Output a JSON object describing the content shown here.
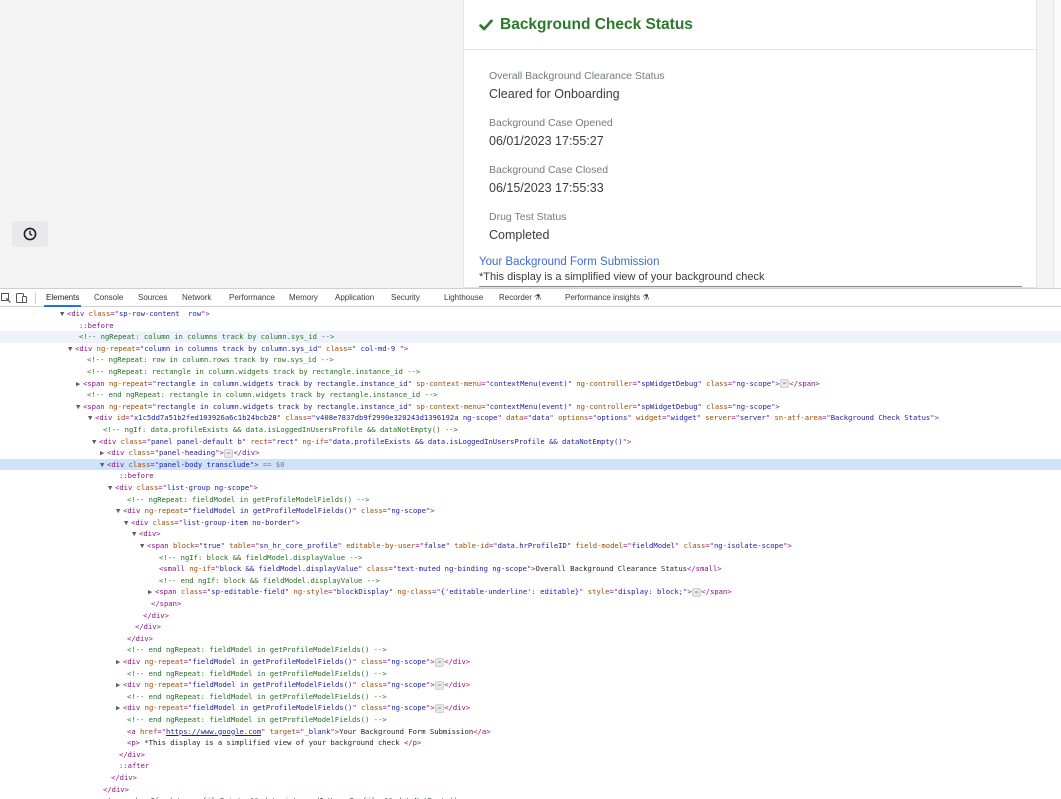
{
  "page": {
    "panel": {
      "title": "Background Check Status",
      "fields": [
        {
          "label": "Overall Background Clearance Status",
          "value": "Cleared for Onboarding"
        },
        {
          "label": "Background Case Opened",
          "value": "06/01/2023 17:55:27"
        },
        {
          "label": "Background Case Closed",
          "value": "06/15/2023 17:55:33"
        },
        {
          "label": "Drug Test Status",
          "value": "Completed"
        }
      ],
      "link_text": "Your Background Form Submission",
      "note": "*This display is a simplified view of your background check"
    }
  },
  "devtools": {
    "tabs": [
      "Elements",
      "Console",
      "Sources",
      "Network",
      "Performance",
      "Memory",
      "Application",
      "Security",
      "Lighthouse",
      "Recorder",
      "Performance insights"
    ],
    "active_tab": "Elements",
    "colors": {
      "accent": "#1a73e8",
      "success": "#2b7a2b",
      "link": "#3f6ad8"
    }
  },
  "tree": [
    {
      "tw": "▼",
      "segs": [
        [
          "tag",
          "<div "
        ],
        [
          "an",
          "class"
        ],
        [
          "tag",
          "=\""
        ],
        [
          "av",
          "sp-row-content  row"
        ],
        [
          "tag",
          "\">"
        ]
      ]
    },
    {
      "tw": "",
      "segs": [
        [
          "ps",
          "::before"
        ]
      ]
    },
    {
      "tw": "",
      "segs": [
        [
          "cm",
          "<!-- ngRepeat: column in columns track by column.sys_id -->"
        ]
      ]
    },
    {
      "tw": "▼",
      "segs": [
        [
          "tag",
          "<div "
        ],
        [
          "an",
          "ng-repeat"
        ],
        [
          "tag",
          "=\""
        ],
        [
          "av",
          "column in columns track by column.sys_id"
        ],
        [
          "tag",
          "\" "
        ],
        [
          "an",
          "class"
        ],
        [
          "tag",
          "=\""
        ],
        [
          "av",
          " col-md-9 "
        ],
        [
          "tag",
          "\">"
        ]
      ]
    },
    {
      "tw": "",
      "segs": [
        [
          "cm",
          "<!-- ngRepeat: row in column.rows track by row.sys_id -->"
        ]
      ]
    },
    {
      "tw": "",
      "segs": [
        [
          "cm",
          "<!-- ngRepeat: rectangle in column.widgets track by rectangle.instance_id -->"
        ]
      ]
    },
    {
      "tw": "▶",
      "segs": [
        [
          "tag",
          "<span "
        ],
        [
          "an",
          "ng-repeat"
        ],
        [
          "tag",
          "=\""
        ],
        [
          "av",
          "rectangle in column.widgets track by rectangle.instance_id"
        ],
        [
          "tag",
          "\" "
        ],
        [
          "an",
          "sp-context-menu"
        ],
        [
          "tag",
          "=\""
        ],
        [
          "av",
          "contextMenu(event)"
        ],
        [
          "tag",
          "\" "
        ],
        [
          "an",
          "ng-controller"
        ],
        [
          "tag",
          "=\""
        ],
        [
          "av",
          "spWidgetDebug"
        ],
        [
          "tag",
          "\" "
        ],
        [
          "an",
          "class"
        ],
        [
          "tag",
          "=\""
        ],
        [
          "av",
          "ng-scope"
        ],
        [
          "tag",
          "\">"
        ],
        [
          "ell",
          "⋯"
        ],
        [
          "tag",
          "</span>"
        ]
      ]
    },
    {
      "tw": "",
      "segs": [
        [
          "cm",
          "<!-- end ngRepeat: rectangle in column.widgets track by rectangle.instance_id -->"
        ]
      ]
    },
    {
      "tw": "▼",
      "segs": [
        [
          "tag",
          "<span "
        ],
        [
          "an",
          "ng-repeat"
        ],
        [
          "tag",
          "=\""
        ],
        [
          "av",
          "rectangle in column.widgets track by rectangle.instance_id"
        ],
        [
          "tag",
          "\" "
        ],
        [
          "an",
          "sp-context-menu"
        ],
        [
          "tag",
          "=\""
        ],
        [
          "av",
          "contextMenu(event)"
        ],
        [
          "tag",
          "\" "
        ],
        [
          "an",
          "ng-controller"
        ],
        [
          "tag",
          "=\""
        ],
        [
          "av",
          "spWidgetDebug"
        ],
        [
          "tag",
          "\" "
        ],
        [
          "an",
          "class"
        ],
        [
          "tag",
          "=\""
        ],
        [
          "av",
          "ng-scope"
        ],
        [
          "tag",
          "\">"
        ]
      ]
    },
    {
      "tw": "▼",
      "segs": [
        [
          "tag",
          "<div "
        ],
        [
          "an",
          "id"
        ],
        [
          "tag",
          "=\""
        ],
        [
          "av",
          "x1c5dd7a51b2fed103926a6c1b24bcb28"
        ],
        [
          "tag",
          "\" "
        ],
        [
          "an",
          "class"
        ],
        [
          "tag",
          "=\""
        ],
        [
          "av",
          "v408e7837db9f2990e320243d1396192a ng-scope"
        ],
        [
          "tag",
          "\" "
        ],
        [
          "an",
          "data"
        ],
        [
          "tag",
          "=\""
        ],
        [
          "av",
          "data"
        ],
        [
          "tag",
          "\" "
        ],
        [
          "an",
          "options"
        ],
        [
          "tag",
          "=\""
        ],
        [
          "av",
          "options"
        ],
        [
          "tag",
          "\" "
        ],
        [
          "an",
          "widget"
        ],
        [
          "tag",
          "=\""
        ],
        [
          "av",
          "widget"
        ],
        [
          "tag",
          "\" "
        ],
        [
          "an",
          "server"
        ],
        [
          "tag",
          "=\""
        ],
        [
          "av",
          "server"
        ],
        [
          "tag",
          "\" "
        ],
        [
          "an",
          "sn-atf-area"
        ],
        [
          "tag",
          "=\""
        ],
        [
          "av",
          "Background Check Status"
        ],
        [
          "tag",
          "\">"
        ]
      ]
    },
    {
      "tw": "",
      "segs": [
        [
          "cm",
          "<!-- ngIf: data.profileExists && data.isLoggedInUsersProfile && dataNotEmpty() -->"
        ]
      ]
    },
    {
      "tw": "▼",
      "segs": [
        [
          "tag",
          "<div "
        ],
        [
          "an",
          "class"
        ],
        [
          "tag",
          "=\""
        ],
        [
          "av",
          "panel panel-default b"
        ],
        [
          "tag",
          "\" "
        ],
        [
          "an",
          "rect"
        ],
        [
          "tag",
          "=\""
        ],
        [
          "av",
          "rect"
        ],
        [
          "tag",
          "\" "
        ],
        [
          "an",
          "ng-if"
        ],
        [
          "tag",
          "=\""
        ],
        [
          "av",
          "data.profileExists && data.isLoggedInUsersProfile && dataNotEmpty()"
        ],
        [
          "tag",
          "\">"
        ]
      ]
    },
    {
      "tw": "▶",
      "segs": [
        [
          "tag",
          "<div "
        ],
        [
          "an",
          "class"
        ],
        [
          "tag",
          "=\""
        ],
        [
          "av",
          "panel-heading"
        ],
        [
          "tag",
          "\">"
        ],
        [
          "ell",
          "⋯"
        ],
        [
          "tag",
          "</div>"
        ]
      ]
    },
    {
      "tw": "▼",
      "segs": [
        [
          "tag",
          "<div "
        ],
        [
          "an",
          "class"
        ],
        [
          "tag",
          "=\""
        ],
        [
          "av",
          "panel-body transclude"
        ],
        [
          "tag",
          "\">"
        ],
        [
          "eq0",
          " == $0"
        ]
      ]
    },
    {
      "tw": "",
      "segs": [
        [
          "ps",
          "::before"
        ]
      ]
    },
    {
      "tw": "▼",
      "segs": [
        [
          "tag",
          "<div "
        ],
        [
          "an",
          "class"
        ],
        [
          "tag",
          "=\""
        ],
        [
          "av",
          "list-group ng-scope"
        ],
        [
          "tag",
          "\">"
        ]
      ]
    },
    {
      "tw": "",
      "segs": [
        [
          "cm",
          "<!-- ngRepeat: fieldModel in getProfileModelFields() -->"
        ]
      ]
    },
    {
      "tw": "▼",
      "segs": [
        [
          "tag",
          "<div "
        ],
        [
          "an",
          "ng-repeat"
        ],
        [
          "tag",
          "=\""
        ],
        [
          "av",
          "fieldModel in getProfileModelFields()"
        ],
        [
          "tag",
          "\" "
        ],
        [
          "an",
          "class"
        ],
        [
          "tag",
          "=\""
        ],
        [
          "av",
          "ng-scope"
        ],
        [
          "tag",
          "\">"
        ]
      ]
    },
    {
      "tw": "▼",
      "segs": [
        [
          "tag",
          "<div "
        ],
        [
          "an",
          "class"
        ],
        [
          "tag",
          "=\""
        ],
        [
          "av",
          "list-group-item no-border"
        ],
        [
          "tag",
          "\">"
        ]
      ]
    },
    {
      "tw": "▼",
      "segs": [
        [
          "tag",
          "<div>"
        ]
      ]
    },
    {
      "tw": "▼",
      "segs": [
        [
          "tag",
          "<span "
        ],
        [
          "an",
          "block"
        ],
        [
          "tag",
          "=\""
        ],
        [
          "av",
          "true"
        ],
        [
          "tag",
          "\" "
        ],
        [
          "an",
          "table"
        ],
        [
          "tag",
          "=\""
        ],
        [
          "av",
          "sn_hr_core_profile"
        ],
        [
          "tag",
          "\" "
        ],
        [
          "an",
          "editable-by-user"
        ],
        [
          "tag",
          "=\""
        ],
        [
          "av",
          "false"
        ],
        [
          "tag",
          "\" "
        ],
        [
          "an",
          "table-id"
        ],
        [
          "tag",
          "=\""
        ],
        [
          "av",
          "data.hrProfileID"
        ],
        [
          "tag",
          "\" "
        ],
        [
          "an",
          "field-model"
        ],
        [
          "tag",
          "=\""
        ],
        [
          "av",
          "fieldModel"
        ],
        [
          "tag",
          "\" "
        ],
        [
          "an",
          "class"
        ],
        [
          "tag",
          "=\""
        ],
        [
          "av",
          "ng-isolate-scope"
        ],
        [
          "tag",
          "\">"
        ]
      ]
    },
    {
      "tw": "",
      "segs": [
        [
          "cm",
          "<!-- ngIf: block && fieldModel.displayValue -->"
        ]
      ]
    },
    {
      "tw": "",
      "segs": [
        [
          "tag",
          "<small "
        ],
        [
          "an",
          "ng-if"
        ],
        [
          "tag",
          "=\""
        ],
        [
          "av",
          "block && fieldModel.displayValue"
        ],
        [
          "tag",
          "\" "
        ],
        [
          "an",
          "class"
        ],
        [
          "tag",
          "=\""
        ],
        [
          "av",
          "text-muted ng-binding ng-scope"
        ],
        [
          "tag",
          "\">"
        ],
        [
          "tx",
          "Overall Background Clearance Status"
        ],
        [
          "tag",
          "</small>"
        ]
      ]
    },
    {
      "tw": "",
      "segs": [
        [
          "cm",
          "<!-- end ngIf: block && fieldModel.displayValue -->"
        ]
      ]
    },
    {
      "tw": "▶",
      "segs": [
        [
          "tag",
          "<span "
        ],
        [
          "an",
          "class"
        ],
        [
          "tag",
          "=\""
        ],
        [
          "av",
          "sp-editable-field"
        ],
        [
          "tag",
          "\" "
        ],
        [
          "an",
          "ng-style"
        ],
        [
          "tag",
          "=\""
        ],
        [
          "av",
          "blockDisplay"
        ],
        [
          "tag",
          "\" "
        ],
        [
          "an",
          "ng-class"
        ],
        [
          "tag",
          "=\""
        ],
        [
          "av",
          "{'editable-underline': editable}"
        ],
        [
          "tag",
          "\" "
        ],
        [
          "an",
          "style"
        ],
        [
          "tag",
          "=\""
        ],
        [
          "av",
          "display: block;"
        ],
        [
          "tag",
          "\">"
        ],
        [
          "ell",
          "⋯"
        ],
        [
          "tag",
          "</span>"
        ]
      ]
    },
    {
      "tw": "",
      "segs": [
        [
          "tag",
          "</span>"
        ]
      ]
    },
    {
      "tw": "",
      "segs": [
        [
          "tag",
          "</div>"
        ]
      ]
    },
    {
      "tw": "",
      "segs": [
        [
          "tag",
          "</div>"
        ]
      ]
    },
    {
      "tw": "",
      "segs": [
        [
          "tag",
          "</div>"
        ]
      ]
    },
    {
      "tw": "",
      "segs": [
        [
          "cm",
          "<!-- end ngRepeat: fieldModel in getProfileModelFields() -->"
        ]
      ]
    },
    {
      "tw": "▶",
      "segs": [
        [
          "tag",
          "<div "
        ],
        [
          "an",
          "ng-repeat"
        ],
        [
          "tag",
          "=\""
        ],
        [
          "av",
          "fieldModel in getProfileModelFields()"
        ],
        [
          "tag",
          "\" "
        ],
        [
          "an",
          "class"
        ],
        [
          "tag",
          "=\""
        ],
        [
          "av",
          "ng-scope"
        ],
        [
          "tag",
          "\">"
        ],
        [
          "ell",
          "⋯"
        ],
        [
          "tag",
          "</div>"
        ]
      ]
    },
    {
      "tw": "",
      "segs": [
        [
          "cm",
          "<!-- end ngRepeat: fieldModel in getProfileModelFields() -->"
        ]
      ]
    },
    {
      "tw": "▶",
      "segs": [
        [
          "tag",
          "<div "
        ],
        [
          "an",
          "ng-repeat"
        ],
        [
          "tag",
          "=\""
        ],
        [
          "av",
          "fieldModel in getProfileModelFields()"
        ],
        [
          "tag",
          "\" "
        ],
        [
          "an",
          "class"
        ],
        [
          "tag",
          "=\""
        ],
        [
          "av",
          "ng-scope"
        ],
        [
          "tag",
          "\">"
        ],
        [
          "ell",
          "⋯"
        ],
        [
          "tag",
          "</div>"
        ]
      ]
    },
    {
      "tw": "",
      "segs": [
        [
          "cm",
          "<!-- end ngRepeat: fieldModel in getProfileModelFields() -->"
        ]
      ]
    },
    {
      "tw": "▶",
      "segs": [
        [
          "tag",
          "<div "
        ],
        [
          "an",
          "ng-repeat"
        ],
        [
          "tag",
          "=\""
        ],
        [
          "av",
          "fieldModel in getProfileModelFields()"
        ],
        [
          "tag",
          "\" "
        ],
        [
          "an",
          "class"
        ],
        [
          "tag",
          "=\""
        ],
        [
          "av",
          "ng-scope"
        ],
        [
          "tag",
          "\">"
        ],
        [
          "ell",
          "⋯"
        ],
        [
          "tag",
          "</div>"
        ]
      ]
    },
    {
      "tw": "",
      "segs": [
        [
          "cm",
          "<!-- end ngRepeat: fieldModel in getProfileModelFields() -->"
        ]
      ]
    },
    {
      "tw": "",
      "segs": [
        [
          "tag",
          "<a "
        ],
        [
          "an",
          "href"
        ],
        [
          "tag",
          "=\""
        ],
        [
          "lk",
          "https://www.google.com"
        ],
        [
          "tag",
          "\" "
        ],
        [
          "an",
          "target"
        ],
        [
          "tag",
          "=\""
        ],
        [
          "av",
          "_blank"
        ],
        [
          "tag",
          "\">"
        ],
        [
          "tx",
          "Your Background Form Submission"
        ],
        [
          "tag",
          "</a>"
        ]
      ]
    },
    {
      "tw": "",
      "segs": [
        [
          "tag",
          "<p>"
        ],
        [
          "tx",
          " *This display is a simplified view of your background check "
        ],
        [
          "tag",
          "</p>"
        ]
      ]
    },
    {
      "tw": "",
      "segs": [
        [
          "tag",
          "</div>"
        ]
      ]
    },
    {
      "tw": "",
      "segs": [
        [
          "ps",
          "::after"
        ]
      ]
    },
    {
      "tw": "",
      "segs": [
        [
          "tag",
          "</div>"
        ]
      ]
    },
    {
      "tw": "",
      "segs": [
        [
          "tag",
          "</div>"
        ]
      ]
    },
    {
      "tw": "",
      "segs": [
        [
          "cm",
          "<!-- end ngIf: data.profileExists && data.isLoggedInUsersProfile && dataNotEmpty() -->"
        ]
      ]
    }
  ]
}
